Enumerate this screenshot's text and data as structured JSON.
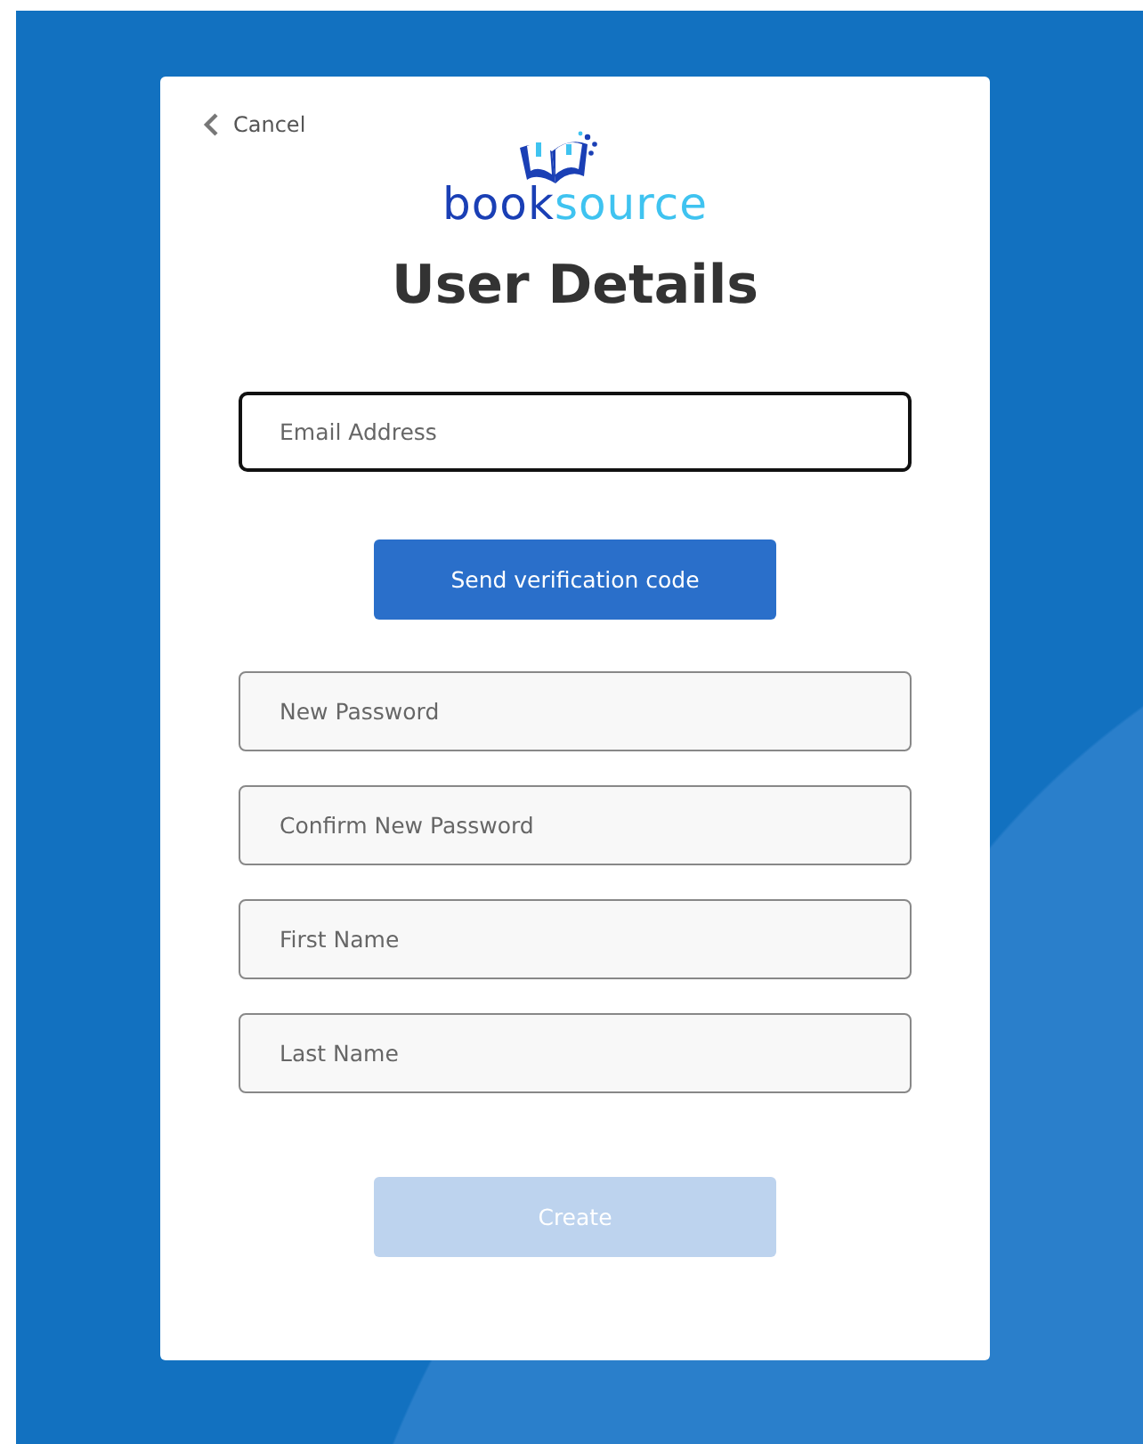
{
  "cancel": {
    "label": "Cancel"
  },
  "logo": {
    "parts": [
      "book",
      "source"
    ]
  },
  "title": "User Details",
  "email": {
    "placeholder": "Email Address",
    "focused": true
  },
  "send_button": {
    "label": "Send verification code",
    "disabled": false
  },
  "fields": [
    {
      "placeholder": "New Password",
      "focused": false
    },
    {
      "placeholder": "Confirm New Password",
      "focused": false
    },
    {
      "placeholder": "First Name",
      "focused": false
    },
    {
      "placeholder": "Last Name",
      "focused": false
    }
  ],
  "create_button": {
    "label": "Create",
    "disabled": true
  }
}
